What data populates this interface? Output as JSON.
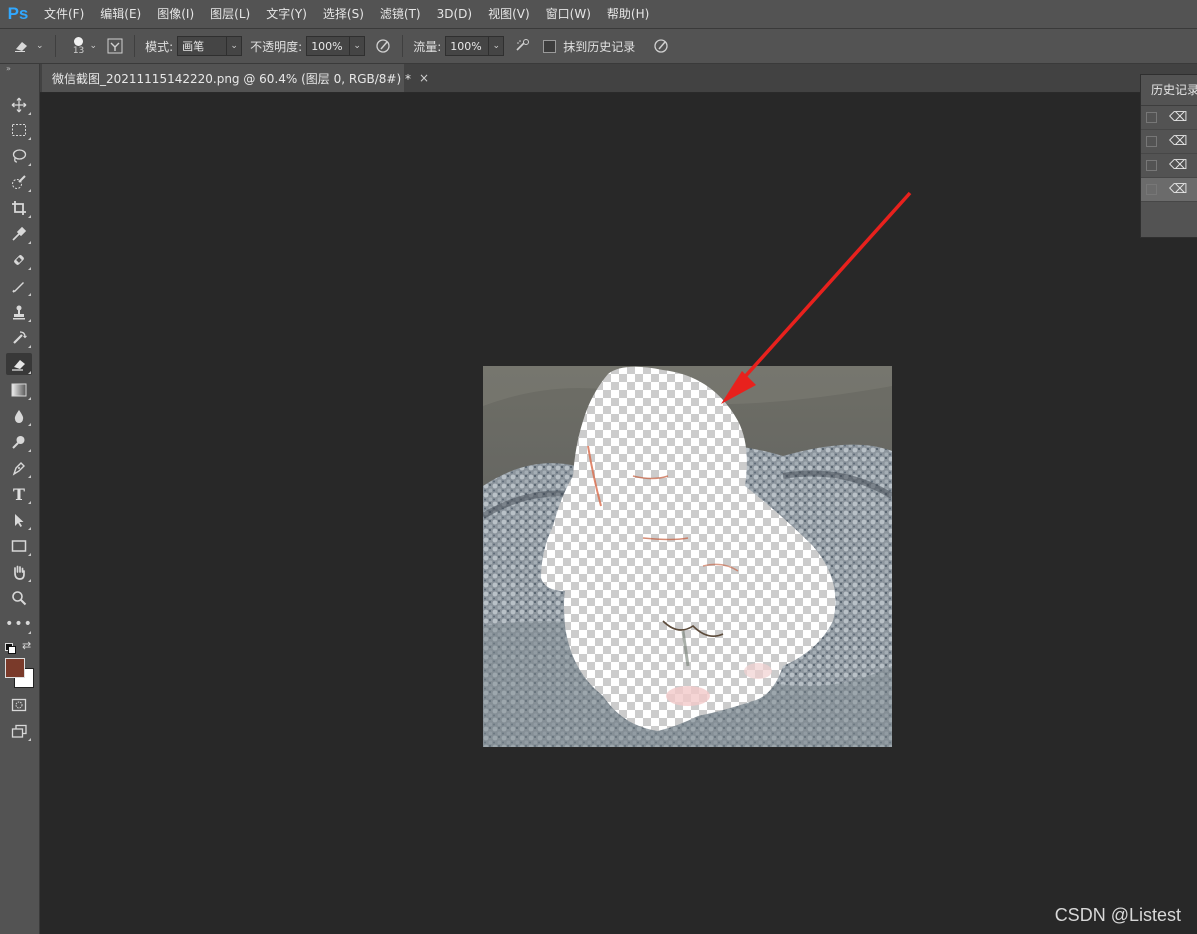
{
  "app": {
    "logo": "Ps"
  },
  "menu": [
    {
      "label": "文件(F)"
    },
    {
      "label": "编辑(E)"
    },
    {
      "label": "图像(I)"
    },
    {
      "label": "图层(L)"
    },
    {
      "label": "文字(Y)"
    },
    {
      "label": "选择(S)"
    },
    {
      "label": "滤镜(T)"
    },
    {
      "label": "3D(D)"
    },
    {
      "label": "视图(V)"
    },
    {
      "label": "窗口(W)"
    },
    {
      "label": "帮助(H)"
    }
  ],
  "options": {
    "brush_size": "13",
    "mode_label": "模式:",
    "mode_value": "画笔",
    "opacity_label": "不透明度:",
    "opacity_value": "100%",
    "flow_label": "流量:",
    "flow_value": "100%",
    "erase_history_label": "抹到历史记录"
  },
  "document": {
    "tab_title": "微信截图_20211115142220.png @ 60.4% (图层 0, RGB/8#) *",
    "close": "×"
  },
  "history": {
    "title": "历史记录",
    "rows": 4,
    "selected_row": 4
  },
  "colors": {
    "foreground": "#7a3a2a",
    "background": "#ffffff",
    "arrow": "#e8211d",
    "accent": "#31a8ff"
  },
  "watermark": "CSDN @Listest"
}
